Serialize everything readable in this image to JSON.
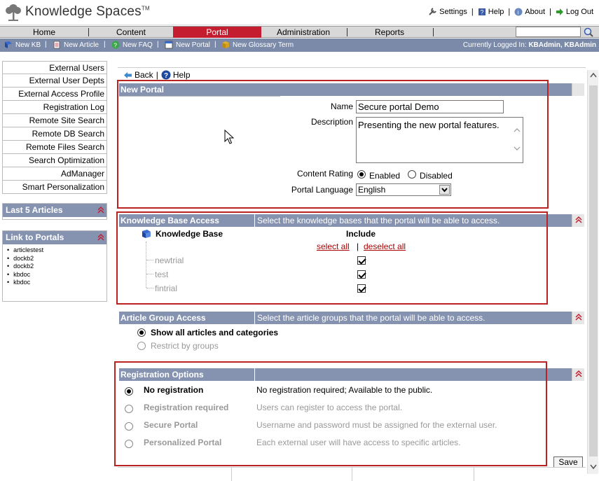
{
  "app": {
    "title": "Knowledge Spaces",
    "tm": "TM"
  },
  "header_links": {
    "settings": "Settings",
    "help": "Help",
    "about": "About",
    "logout": "Log Out"
  },
  "nav": {
    "tabs": [
      "Home",
      "Content",
      "Portal",
      "Administration",
      "Reports"
    ],
    "active": "Portal"
  },
  "subbar": {
    "items": [
      "New KB",
      "New Article",
      "New FAQ",
      "New Portal",
      "New Glossary Term"
    ],
    "logged_in_label": "Currently Logged In:",
    "logged_in_user": "KBAdmin, KBAdmin"
  },
  "sidebar": {
    "links": [
      "External Users",
      "External User Depts",
      "External Access Profile",
      "Registration Log",
      "Remote Site Search",
      "Remote DB Search",
      "Remote Files Search",
      "Search Optimization",
      "AdManager",
      "Smart Personalization"
    ],
    "last_articles_title": "Last 5 Articles",
    "link_portals_title": "Link to Portals",
    "portals": [
      "articlestest",
      "dockb2",
      "dockb2",
      "kbdoc",
      "kbdoc"
    ]
  },
  "toolbar": {
    "back": "Back",
    "help": "Help"
  },
  "new_portal": {
    "title": "New Portal",
    "name_label": "Name",
    "name_value": "Secure portal Demo",
    "desc_label": "Description",
    "desc_value": "Presenting the new portal features.",
    "rating_label": "Content Rating",
    "rating_enabled": "Enabled",
    "rating_disabled": "Disabled",
    "language_label": "Portal Language",
    "language_value": "English"
  },
  "kb_access": {
    "title": "Knowledge Base Access",
    "hint": "Select the knowledge bases that the portal will be able to access.",
    "col_kb": "Knowledge Base",
    "col_include": "Include",
    "select_all": "select all",
    "deselect_all": "deselect all",
    "items": [
      "newtrial",
      "test",
      "fintrial"
    ]
  },
  "article_access": {
    "title": "Article Group Access",
    "hint": "Select the article groups that the portal will be able to access.",
    "opt_all": "Show all articles and categories",
    "opt_groups": "Restrict by groups"
  },
  "registration": {
    "title": "Registration Options",
    "options": [
      {
        "label": "No registration",
        "desc": "No registration required; Available to the public."
      },
      {
        "label": "Registration required",
        "desc": "Users can register to access the portal."
      },
      {
        "label": "Secure Portal",
        "desc": "Username and password must be assigned for the external user."
      },
      {
        "label": "Personalized Portal",
        "desc": "Each external user will have access to specific articles."
      }
    ]
  },
  "save_label": "Save",
  "colors": {
    "accent": "#c41d2f",
    "header_bar": "#8593b0",
    "subbar": "#7a8aa8",
    "highlight_box": "#b22222"
  }
}
